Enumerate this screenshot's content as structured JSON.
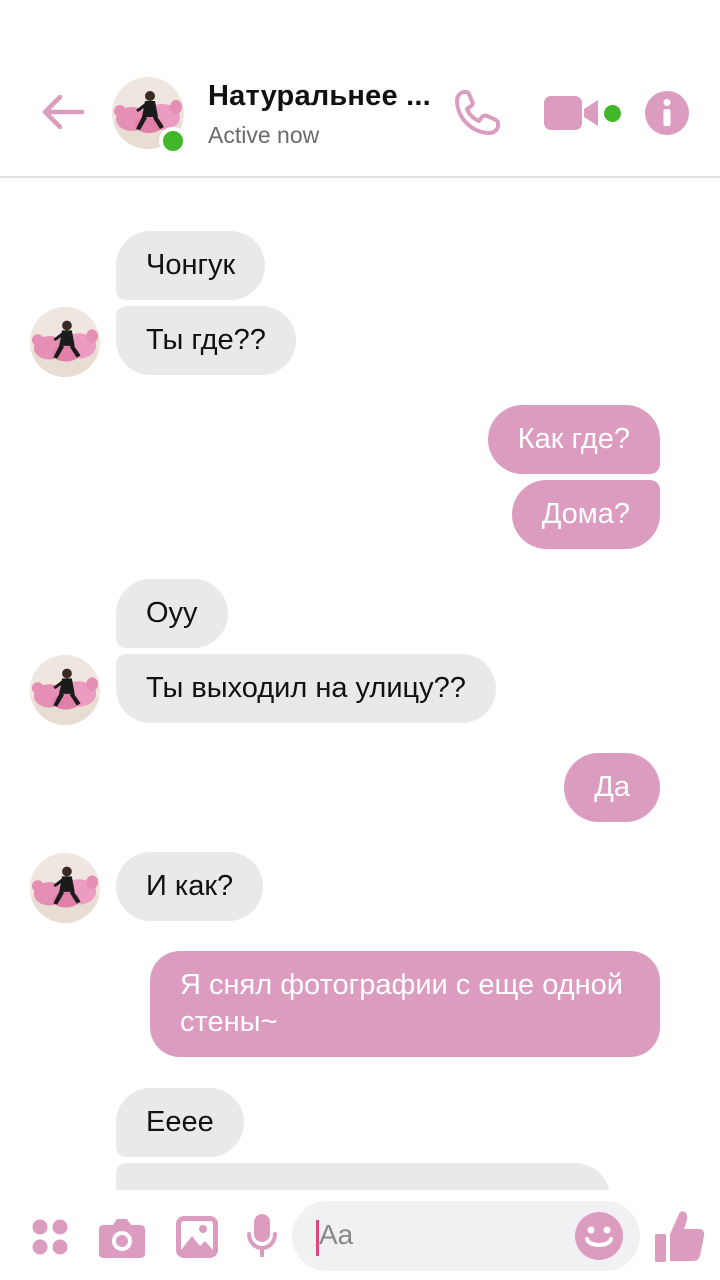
{
  "header": {
    "title": "Натуральнее ...",
    "status": "Active now",
    "accent_color": "#dc9cc0",
    "online_color": "#42b72a",
    "icons": [
      "back-arrow-icon",
      "phone-icon",
      "video-camera-icon",
      "info-icon"
    ]
  },
  "messages": [
    {
      "side": "in",
      "text": "Чонгук"
    },
    {
      "side": "in",
      "text": "Ты где??"
    },
    {
      "side": "out",
      "text": "Как где?"
    },
    {
      "side": "out",
      "text": "Дома?"
    },
    {
      "side": "in",
      "text": "Оуу"
    },
    {
      "side": "in",
      "text": "Ты выходил на улицу??"
    },
    {
      "side": "out",
      "text": "Да"
    },
    {
      "side": "in",
      "text": "И как?"
    },
    {
      "side": "out",
      "text": "Я снял фотографии с еще одной стены~"
    },
    {
      "side": "in",
      "text": "Еeee"
    }
  ],
  "composer": {
    "placeholder": "Aa",
    "icons": [
      "apps-icon",
      "camera-icon",
      "gallery-icon",
      "microphone-icon",
      "emoji-icon",
      "thumbs-up-icon"
    ]
  }
}
